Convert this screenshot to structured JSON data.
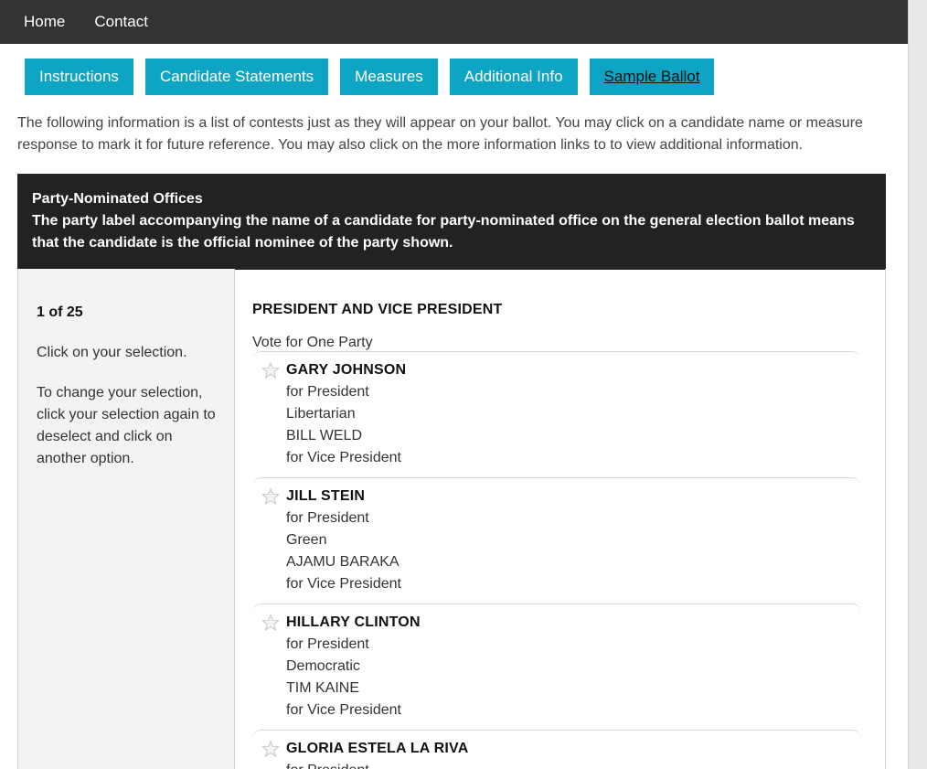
{
  "topnav": {
    "home": "Home",
    "contact": "Contact"
  },
  "tabs": [
    {
      "label": "Instructions"
    },
    {
      "label": "Candidate Statements"
    },
    {
      "label": "Measures"
    },
    {
      "label": "Additional Info"
    },
    {
      "label": "Sample Ballot",
      "active": true
    }
  ],
  "intro": "The following information is a list of contests just as they will appear on your ballot. You may click on a candidate name or measure response to mark it for future reference. You may also click on the more information links to to view additional information.",
  "banner": {
    "title": "Party-Nominated Offices",
    "text": "The party label accompanying the name of a candidate for party-nominated office on the general election ballot means that the candidate is the official nominee of the party shown."
  },
  "sidebar": {
    "counter": "1 of 25",
    "instruction1": "Click on your selection.",
    "instruction2": "To change your selection, click your selection again to deselect and click on another option."
  },
  "contest": {
    "title": "PRESIDENT AND VICE PRESIDENT",
    "vote_for": "Vote for One Party",
    "candidates": [
      {
        "name": "GARY JOHNSON",
        "role": "for President",
        "party": "Libertarian",
        "running_mate": "BILL WELD",
        "running_mate_role": "for Vice President"
      },
      {
        "name": "JILL STEIN",
        "role": "for President",
        "party": "Green",
        "running_mate": "AJAMU BARAKA",
        "running_mate_role": "for Vice President"
      },
      {
        "name": "HILLARY CLINTON",
        "role": "for President",
        "party": "Democratic",
        "running_mate": "TIM KAINE",
        "running_mate_role": "for Vice President"
      },
      {
        "name": "GLORIA ESTELA LA RIVA",
        "role": "for President"
      }
    ]
  },
  "icons": {
    "candidate_marker": "star-icon"
  },
  "colors": {
    "topnav": "#333333",
    "tab": "#0ea5c5",
    "banner": "#222222",
    "sidebar": "#f3f3f3"
  }
}
